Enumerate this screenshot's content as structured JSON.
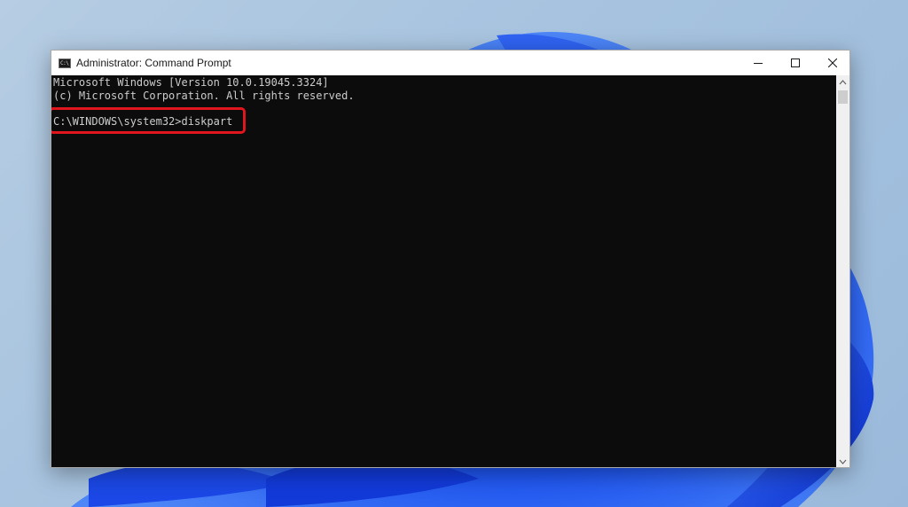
{
  "window": {
    "title": "Administrator: Command Prompt",
    "icon": "command-prompt-icon",
    "icon_text": "C:\\"
  },
  "controls": {
    "minimize_icon": "minimize-icon",
    "maximize_icon": "maximize-icon",
    "close_icon": "close-icon"
  },
  "console": {
    "lines": [
      "Microsoft Windows [Version 10.0.19045.3324]",
      "(c) Microsoft Corporation. All rights reserved.",
      "C:\\WINDOWS\\system32>diskpart"
    ],
    "text_color": "#cccccc",
    "background_color": "#0c0c0c"
  },
  "annotation": {
    "highlight_color": "#e0161c"
  }
}
